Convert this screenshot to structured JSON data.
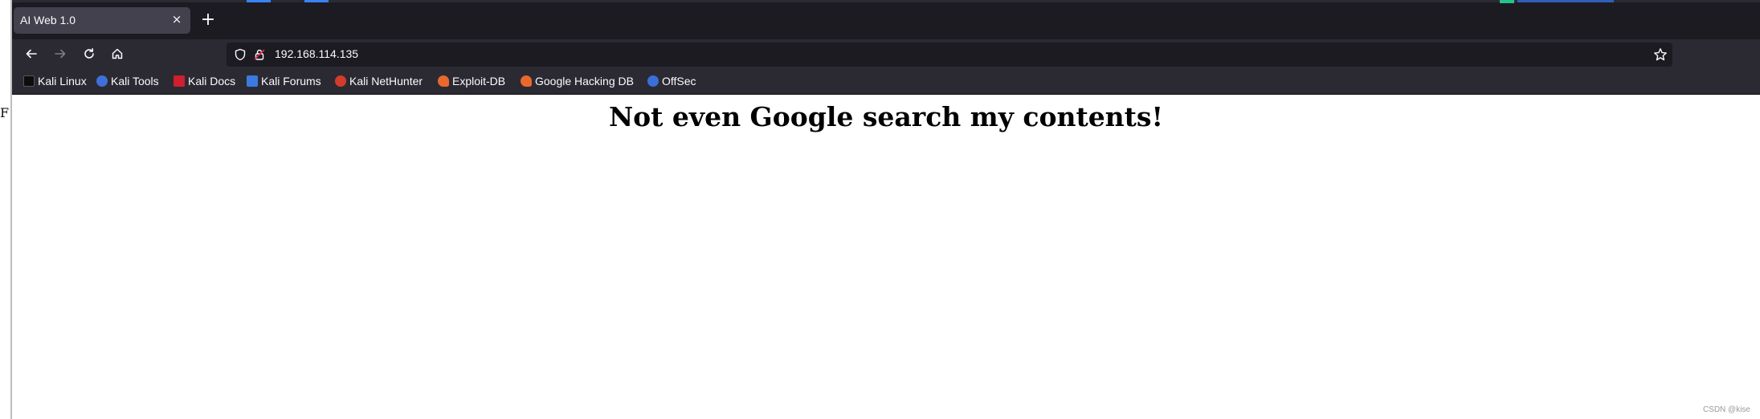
{
  "browser": {
    "tab": {
      "title": "AI Web 1.0",
      "close_glyph": "×"
    },
    "new_tab_glyph": "+",
    "nav": {
      "back_icon": "arrow-left-icon",
      "forward_icon": "arrow-right-icon",
      "reload_icon": "reload-icon",
      "home_icon": "home-icon"
    },
    "url": "192.168.114.135",
    "bookmarks": [
      {
        "label": "Kali Linux",
        "icon": "kali-icon",
        "color": "#1a1a1a"
      },
      {
        "label": "Kali Tools",
        "icon": "kali-tools-icon",
        "color": "#3f6fd8"
      },
      {
        "label": "Kali Docs",
        "icon": "kali-docs-icon",
        "color": "#d01f2f"
      },
      {
        "label": "Kali Forums",
        "icon": "kali-forums-icon",
        "color": "#3b7be0"
      },
      {
        "label": "Kali NetHunter",
        "icon": "nethunter-icon",
        "color": "#d33b2c"
      },
      {
        "label": "Exploit-DB",
        "icon": "exploit-db-icon",
        "color": "#e8692b"
      },
      {
        "label": "Google Hacking DB",
        "icon": "ghdb-icon",
        "color": "#e8692b"
      },
      {
        "label": "OffSec",
        "icon": "offsec-icon",
        "color": "#3a6fd8"
      }
    ]
  },
  "page": {
    "heading": "Not even Google search my contents!"
  },
  "watermark": "CSDN @kise",
  "left_edge_glyph": "F"
}
